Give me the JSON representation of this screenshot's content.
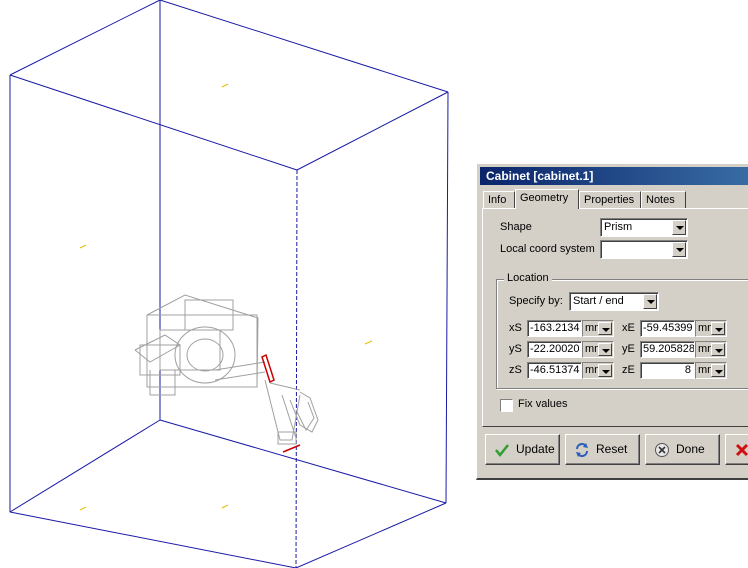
{
  "dialog": {
    "title": "Cabinet [cabinet.1]",
    "tabs": [
      {
        "label": "Info"
      },
      {
        "label": "Geometry"
      },
      {
        "label": "Properties"
      },
      {
        "label": "Notes"
      }
    ],
    "active_tab": "Geometry",
    "shape_label": "Shape",
    "shape_value": "Prism",
    "local_coord_label": "Local coord system",
    "local_coord_value": "",
    "location_group": "Location",
    "specify_by_label": "Specify by:",
    "specify_by_value": "Start / end",
    "coords": {
      "xS": {
        "label": "xS",
        "value": "-163.2134",
        "unit": "mm"
      },
      "yS": {
        "label": "yS",
        "value": "-22.20020",
        "unit": "mm"
      },
      "zS": {
        "label": "zS",
        "value": "-46.51374",
        "unit": "mm"
      },
      "xE": {
        "label": "xE",
        "value": "-59.45399",
        "unit": "mm"
      },
      "yE": {
        "label": "yE",
        "value": "59.205828",
        "unit": "mm"
      },
      "zE": {
        "label": "zE",
        "value": "8",
        "unit": "mm"
      }
    },
    "fix_values_label": "Fix values",
    "fix_values_checked": false,
    "buttons": {
      "update": "Update",
      "reset": "Reset",
      "done": "Done"
    }
  },
  "colors": {
    "title_bar": "#0a246a",
    "box_edges": "#1a1aa6",
    "model_lines": "#a0a0a0",
    "highlight": "#cc0000"
  }
}
